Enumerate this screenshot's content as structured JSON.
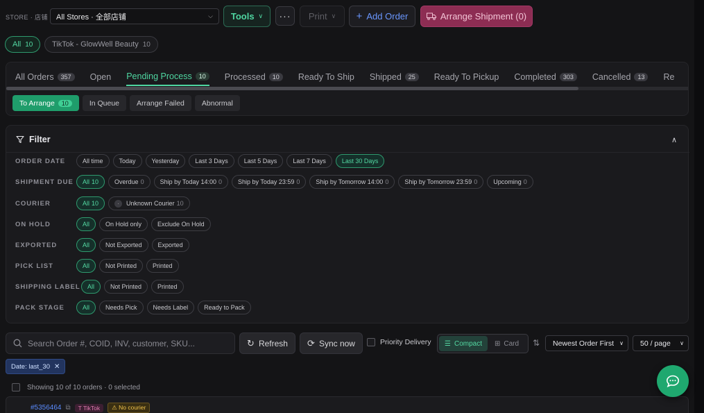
{
  "topbar": {
    "store_label": "STORE · 店铺",
    "store_value": "All Stores · 全部店铺",
    "tools_label": "Tools",
    "more_label": "···",
    "print_label": "Print",
    "add_label": "Add Order",
    "arrange_label": "Arrange Shipment (0)"
  },
  "store_pills": [
    {
      "label": "All",
      "count": "10"
    },
    {
      "label": "TikTok - GlowWell Beauty",
      "count": "10"
    }
  ],
  "tabs": [
    {
      "label": "All Orders",
      "badge": "357"
    },
    {
      "label": "Open",
      "badge": ""
    },
    {
      "label": "Pending Process",
      "badge": "10"
    },
    {
      "label": "Processed",
      "badge": "10"
    },
    {
      "label": "Ready To Ship",
      "badge": ""
    },
    {
      "label": "Shipped",
      "badge": "25"
    },
    {
      "label": "Ready To Pickup",
      "badge": ""
    },
    {
      "label": "Completed",
      "badge": "303"
    },
    {
      "label": "Cancelled",
      "badge": "13"
    },
    {
      "label": "Re",
      "badge": ""
    }
  ],
  "subtabs": [
    {
      "label": "To Arrange",
      "badge": "10"
    },
    {
      "label": "In Queue",
      "badge": ""
    },
    {
      "label": "Arrange Failed",
      "badge": ""
    },
    {
      "label": "Abnormal",
      "badge": ""
    }
  ],
  "filter": {
    "title": "Filter",
    "rows": [
      {
        "label": "ORDER DATE",
        "chips": [
          {
            "t": "All time",
            "n": ""
          },
          {
            "t": "Today",
            "n": ""
          },
          {
            "t": "Yesterday",
            "n": ""
          },
          {
            "t": "Last 3 Days",
            "n": ""
          },
          {
            "t": "Last 5 Days",
            "n": ""
          },
          {
            "t": "Last 7 Days",
            "n": ""
          },
          {
            "t": "Last 30 Days",
            "n": ""
          }
        ]
      },
      {
        "label": "SHIPMENT DUE",
        "chips": [
          {
            "t": "All",
            "n": "10"
          },
          {
            "t": "Overdue",
            "n": "0"
          },
          {
            "t": "Ship by Today 14:00",
            "n": "0"
          },
          {
            "t": "Ship by Today 23:59",
            "n": "0"
          },
          {
            "t": "Ship by Tomorrow 14:00",
            "n": "0"
          },
          {
            "t": "Ship by Tomorrow 23:59",
            "n": "0"
          },
          {
            "t": "Upcoming",
            "n": "0"
          }
        ]
      },
      {
        "label": "COURIER",
        "chips": [
          {
            "t": "All",
            "n": "10"
          },
          {
            "t": "Unknown Courier",
            "n": "10"
          }
        ]
      },
      {
        "label": "ON HOLD",
        "chips": [
          {
            "t": "All",
            "n": ""
          },
          {
            "t": "On Hold only",
            "n": ""
          },
          {
            "t": "Exclude On Hold",
            "n": ""
          }
        ]
      },
      {
        "label": "EXPORTED",
        "chips": [
          {
            "t": "All",
            "n": ""
          },
          {
            "t": "Not Exported",
            "n": ""
          },
          {
            "t": "Exported",
            "n": ""
          }
        ]
      },
      {
        "label": "PICK LIST",
        "chips": [
          {
            "t": "All",
            "n": ""
          },
          {
            "t": "Not Printed",
            "n": ""
          },
          {
            "t": "Printed",
            "n": ""
          }
        ]
      },
      {
        "label": "SHIPPING LABEL",
        "chips": [
          {
            "t": "All",
            "n": ""
          },
          {
            "t": "Not Printed",
            "n": ""
          },
          {
            "t": "Printed",
            "n": ""
          }
        ]
      },
      {
        "label": "PACK STAGE",
        "chips": [
          {
            "t": "All",
            "n": ""
          },
          {
            "t": "Needs Pick",
            "n": ""
          },
          {
            "t": "Needs Label",
            "n": ""
          },
          {
            "t": "Ready to Pack",
            "n": ""
          }
        ]
      }
    ]
  },
  "toolbar": {
    "search_placeholder": "Search Order #, COID, INV, customer, SKU...",
    "refresh_label": "Refresh",
    "sync_label": "Sync now",
    "priority_label": "Priority Delivery",
    "compact_label": "Compact",
    "card_label": "Card",
    "sort_value": "Newest Order First",
    "page_size_value": "50 / page"
  },
  "active_filter_tag": "Date: last_30",
  "summary": "Showing 10 of 10 orders · 0 selected",
  "first_order": {
    "id": "#5356464",
    "platform": "TikTok",
    "warning": "No courier"
  },
  "colors": {
    "accent": "#4fd6a1",
    "arrange": "#8d2d53",
    "link": "#5b8cff",
    "fab": "#1fa86f"
  }
}
